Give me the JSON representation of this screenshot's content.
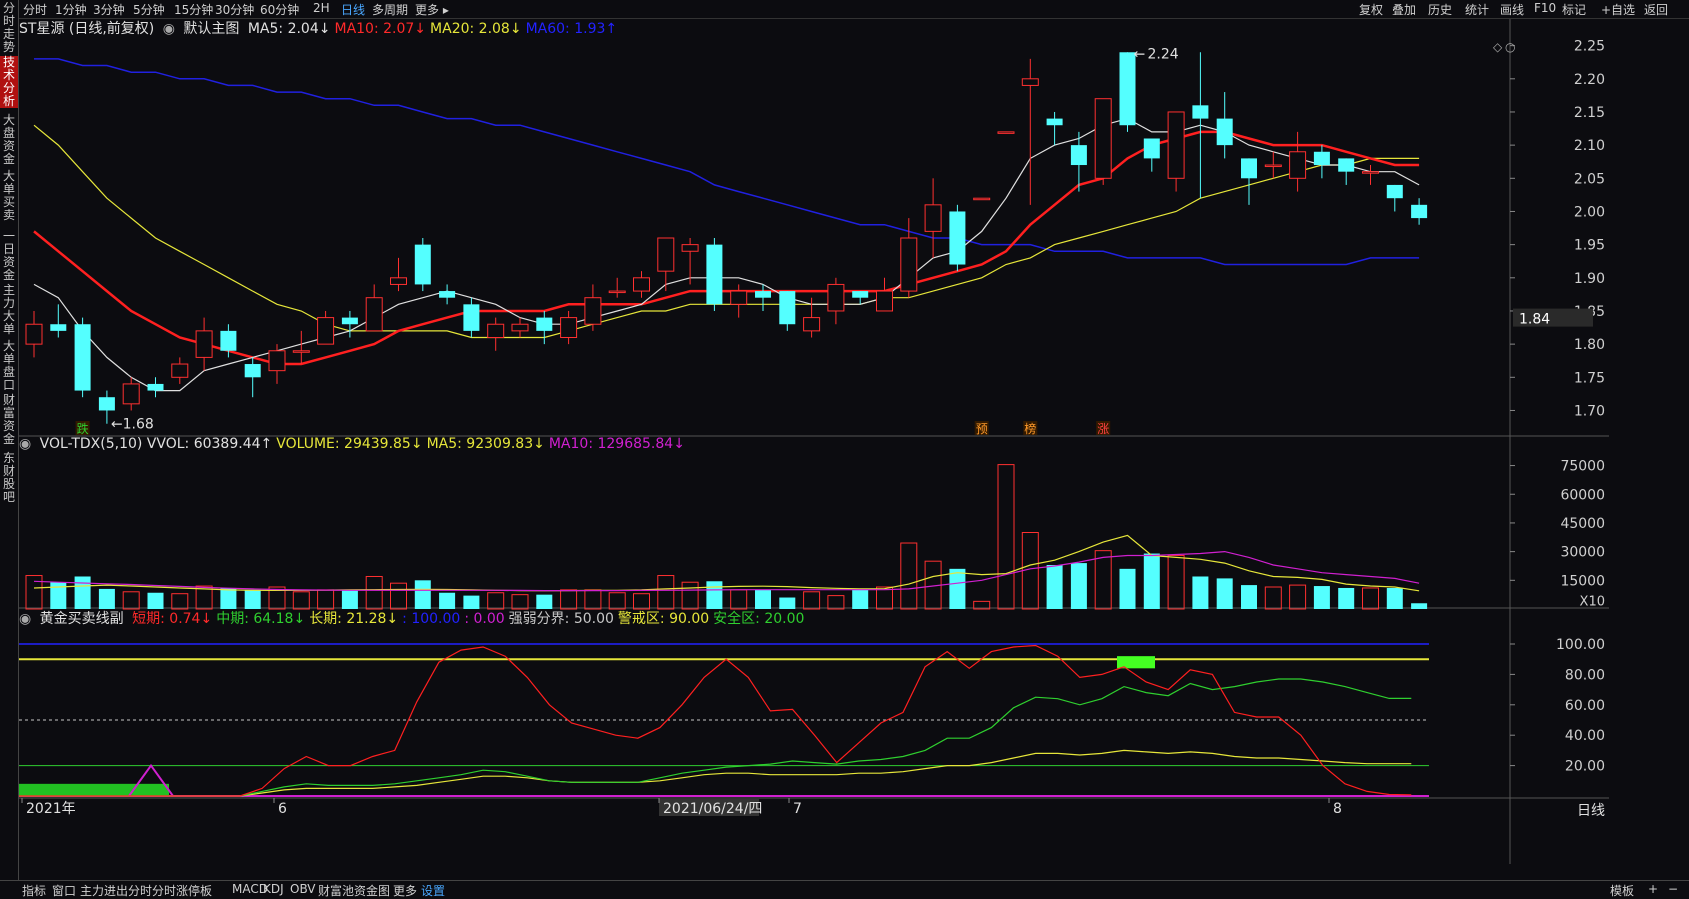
{
  "sidebar": {
    "items": [
      "分时走势",
      "技术分析",
      "大盘资金",
      "大单买卖",
      "一日资金",
      "主力大单",
      "大单盘口",
      "财富资金",
      "东财股吧"
    ],
    "active": 1
  },
  "topbar": {
    "periods": [
      "分时",
      "1分钟",
      "3分钟",
      "5分钟",
      "15分钟",
      "30分钟",
      "60分钟",
      "2H",
      "日线",
      "多周期",
      "更多 ▸"
    ],
    "selected": "日线",
    "right_buttons": [
      "复权",
      "叠加",
      "历史",
      "统计",
      "画线",
      "F10",
      "标记",
      "+自选",
      "返回"
    ]
  },
  "main_chart": {
    "stock": "ST星源 (日线,前复权)",
    "template": "默认主图",
    "ma_labels": [
      {
        "text": "MA5: 2.04",
        "arrow": "↓",
        "color": "#e0e0e0"
      },
      {
        "text": "MA10: 2.07",
        "arrow": "↓",
        "color": "#ff2a2a"
      },
      {
        "text": "MA20: 2.08",
        "arrow": "↓",
        "color": "#e6e63a"
      },
      {
        "text": "MA60: 1.93",
        "arrow": "↑",
        "color": "#2222ff"
      }
    ],
    "y_ticks": [
      "2.25",
      "2.20",
      "2.15",
      "2.10",
      "2.05",
      "2.00",
      "1.95",
      "1.90",
      "1.85",
      "1.80",
      "1.75",
      "1.70"
    ],
    "price_tag": "1.84",
    "high_label": "2.24",
    "low_label": "1.68",
    "markers": [
      {
        "text": "跌",
        "color": "#2fcf2f"
      },
      {
        "text": "预",
        "color": "#ff9a2a"
      },
      {
        "text": "榜",
        "color": "#ff9a2a"
      },
      {
        "text": "涨",
        "color": "#ff4040"
      }
    ]
  },
  "volume_chart": {
    "labels": [
      {
        "text": "VOL-TDX(5,10) VVOL: 60389.44",
        "arrow": "↑",
        "color": "#e0e0e0"
      },
      {
        "text": "VOLUME: 29439.85",
        "arrow": "↓",
        "color": "#e6e63a"
      },
      {
        "text": "MA5: 92309.83",
        "arrow": "↓",
        "color": "#e6e63a"
      },
      {
        "text": "MA10: 129685.84",
        "arrow": "↓",
        "color": "#d020d0"
      }
    ],
    "y_ticks": [
      "75000",
      "60000",
      "45000",
      "30000",
      "15000"
    ],
    "unit": "X10"
  },
  "indicator_chart": {
    "name": "黄金买卖线副",
    "labels": [
      {
        "text": "短期: 0.74",
        "arrow": "↓",
        "color": "#ff2a2a"
      },
      {
        "text": "中期: 64.18",
        "arrow": "↓",
        "color": "#2fcf2f"
      },
      {
        "text": "长期: 21.28",
        "arrow": "↓",
        "color": "#e6e63a"
      },
      {
        "text": ": 100.00",
        "arrow": "",
        "color": "#2222ff"
      },
      {
        "text": ": 0.00",
        "arrow": "",
        "color": "#d020d0"
      },
      {
        "text": "强弱分界: 50.00",
        "arrow": "",
        "color": "#c8c8c8"
      },
      {
        "text": "警戒区: 90.00",
        "arrow": "",
        "color": "#e6e63a"
      },
      {
        "text": "安全区: 20.00",
        "arrow": "",
        "color": "#2fcf2f"
      }
    ],
    "y_ticks": [
      "100.00",
      "80.00",
      "60.00",
      "40.00",
      "20.00"
    ]
  },
  "x_axis": {
    "labels": [
      "2021年",
      "6",
      "2021/06/24/四",
      "7",
      "8"
    ],
    "period": "日线"
  },
  "bottombar": {
    "items": [
      "指标",
      "窗口",
      "主力进出分时",
      "分时涨停板",
      "MACD",
      "KDJ",
      "OBV",
      "财富池资金图",
      "更多",
      "设置"
    ],
    "selected": "设置",
    "right": [
      "模板",
      "+",
      "−"
    ]
  },
  "colors": {
    "up": "#ff3030",
    "down": "#54ffff",
    "ma5": "#e0e0e0",
    "ma10": "#ff2020",
    "ma20": "#e6e63a",
    "ma60": "#2020e0"
  },
  "chart_data": {
    "type": "candlestick",
    "price": {
      "ylim": [
        1.66,
        2.26
      ],
      "candles": [
        [
          1.8,
          1.83,
          1.78,
          1.85
        ],
        [
          1.83,
          1.82,
          1.81,
          1.86
        ],
        [
          1.83,
          1.73,
          1.72,
          1.84
        ],
        [
          1.72,
          1.7,
          1.68,
          1.73
        ],
        [
          1.71,
          1.74,
          1.7,
          1.75
        ],
        [
          1.74,
          1.73,
          1.72,
          1.75
        ],
        [
          1.75,
          1.77,
          1.74,
          1.78
        ],
        [
          1.78,
          1.82,
          1.76,
          1.84
        ],
        [
          1.82,
          1.79,
          1.78,
          1.83
        ],
        [
          1.77,
          1.75,
          1.72,
          1.78
        ],
        [
          1.76,
          1.79,
          1.74,
          1.8
        ],
        [
          1.79,
          1.79,
          1.77,
          1.82
        ],
        [
          1.8,
          1.84,
          1.8,
          1.85
        ],
        [
          1.84,
          1.83,
          1.81,
          1.85
        ],
        [
          1.82,
          1.87,
          1.82,
          1.89
        ],
        [
          1.89,
          1.9,
          1.88,
          1.93
        ],
        [
          1.95,
          1.89,
          1.88,
          1.96
        ],
        [
          1.88,
          1.87,
          1.86,
          1.89
        ],
        [
          1.86,
          1.82,
          1.81,
          1.87
        ],
        [
          1.81,
          1.83,
          1.79,
          1.84
        ],
        [
          1.82,
          1.83,
          1.81,
          1.84
        ],
        [
          1.84,
          1.82,
          1.8,
          1.85
        ],
        [
          1.81,
          1.84,
          1.8,
          1.85
        ],
        [
          1.83,
          1.87,
          1.82,
          1.89
        ],
        [
          1.88,
          1.88,
          1.87,
          1.9
        ],
        [
          1.88,
          1.9,
          1.87,
          1.91
        ],
        [
          1.91,
          1.96,
          1.88,
          1.95
        ],
        [
          1.94,
          1.95,
          1.89,
          1.96
        ],
        [
          1.95,
          1.86,
          1.85,
          1.96
        ],
        [
          1.86,
          1.88,
          1.84,
          1.89
        ],
        [
          1.88,
          1.87,
          1.85,
          1.89
        ],
        [
          1.88,
          1.83,
          1.82,
          1.88
        ],
        [
          1.82,
          1.84,
          1.81,
          1.87
        ],
        [
          1.85,
          1.89,
          1.83,
          1.9
        ],
        [
          1.88,
          1.87,
          1.86,
          1.88
        ],
        [
          1.85,
          1.88,
          1.85,
          1.9
        ],
        [
          1.88,
          1.96,
          1.87,
          1.99
        ],
        [
          1.97,
          2.01,
          1.93,
          2.05
        ],
        [
          2.0,
          1.92,
          1.91,
          2.01
        ],
        [
          2.02,
          2.02,
          2.02,
          2.02
        ],
        [
          2.12,
          2.12,
          2.12,
          2.12
        ],
        [
          2.19,
          2.2,
          2.01,
          2.23
        ],
        [
          2.14,
          2.13,
          2.1,
          2.15
        ],
        [
          2.1,
          2.07,
          2.03,
          2.12
        ],
        [
          2.05,
          2.17,
          2.04,
          2.17
        ],
        [
          2.24,
          2.13,
          2.12,
          2.24
        ],
        [
          2.11,
          2.08,
          2.06,
          2.11
        ],
        [
          2.05,
          2.15,
          2.03,
          2.15
        ],
        [
          2.16,
          2.14,
          2.02,
          2.24
        ],
        [
          2.14,
          2.1,
          2.08,
          2.18
        ],
        [
          2.08,
          2.05,
          2.01,
          2.08
        ],
        [
          2.07,
          2.07,
          2.05,
          2.09
        ],
        [
          2.05,
          2.09,
          2.03,
          2.12
        ],
        [
          2.09,
          2.07,
          2.05,
          2.1
        ],
        [
          2.08,
          2.06,
          2.04,
          2.08
        ],
        [
          2.06,
          2.06,
          2.04,
          2.07
        ],
        [
          2.04,
          2.02,
          2.0,
          2.04
        ],
        [
          2.01,
          1.99,
          1.98,
          2.02
        ]
      ],
      "ma5": [
        1.89,
        1.87,
        1.82,
        1.78,
        1.75,
        1.73,
        1.73,
        1.76,
        1.77,
        1.78,
        1.79,
        1.8,
        1.81,
        1.82,
        1.84,
        1.86,
        1.87,
        1.88,
        1.87,
        1.86,
        1.84,
        1.83,
        1.83,
        1.84,
        1.85,
        1.86,
        1.89,
        1.9,
        1.9,
        1.9,
        1.89,
        1.87,
        1.86,
        1.86,
        1.86,
        1.87,
        1.9,
        1.93,
        1.94,
        1.97,
        2.02,
        2.08,
        2.1,
        2.11,
        2.13,
        2.14,
        2.12,
        2.12,
        2.13,
        2.12,
        2.1,
        2.09,
        2.08,
        2.07,
        2.07,
        2.06,
        2.06,
        2.04
      ],
      "ma10": [
        1.97,
        1.94,
        1.91,
        1.88,
        1.85,
        1.83,
        1.81,
        1.8,
        1.79,
        1.78,
        1.77,
        1.77,
        1.78,
        1.79,
        1.8,
        1.82,
        1.83,
        1.84,
        1.85,
        1.85,
        1.85,
        1.85,
        1.86,
        1.86,
        1.86,
        1.86,
        1.87,
        1.88,
        1.88,
        1.88,
        1.88,
        1.88,
        1.88,
        1.88,
        1.88,
        1.88,
        1.89,
        1.9,
        1.91,
        1.92,
        1.94,
        1.98,
        2.01,
        2.04,
        2.05,
        2.08,
        2.1,
        2.11,
        2.12,
        2.12,
        2.11,
        2.1,
        2.1,
        2.1,
        2.09,
        2.08,
        2.07,
        2.07
      ],
      "ma20": [
        2.13,
        2.1,
        2.06,
        2.02,
        1.99,
        1.96,
        1.94,
        1.92,
        1.9,
        1.88,
        1.86,
        1.85,
        1.83,
        1.82,
        1.82,
        1.82,
        1.82,
        1.82,
        1.81,
        1.81,
        1.81,
        1.81,
        1.82,
        1.83,
        1.84,
        1.85,
        1.85,
        1.86,
        1.86,
        1.86,
        1.86,
        1.86,
        1.86,
        1.86,
        1.86,
        1.87,
        1.87,
        1.88,
        1.89,
        1.9,
        1.92,
        1.93,
        1.95,
        1.96,
        1.97,
        1.98,
        1.99,
        2.0,
        2.02,
        2.03,
        2.04,
        2.05,
        2.06,
        2.07,
        2.07,
        2.08,
        2.08,
        2.08
      ],
      "ma60": [
        2.23,
        2.23,
        2.22,
        2.22,
        2.21,
        2.21,
        2.2,
        2.2,
        2.19,
        2.19,
        2.18,
        2.18,
        2.17,
        2.17,
        2.16,
        2.16,
        2.15,
        2.14,
        2.14,
        2.13,
        2.13,
        2.12,
        2.11,
        2.1,
        2.09,
        2.08,
        2.07,
        2.06,
        2.04,
        2.03,
        2.02,
        2.01,
        2.0,
        1.99,
        1.98,
        1.98,
        1.97,
        1.96,
        1.96,
        1.95,
        1.95,
        1.95,
        1.94,
        1.94,
        1.94,
        1.93,
        1.93,
        1.93,
        1.93,
        1.92,
        1.92,
        1.92,
        1.92,
        1.92,
        1.92,
        1.93,
        1.93,
        1.93
      ]
    },
    "volume": {
      "ylim": [
        0,
        80000
      ],
      "values": [
        17500,
        14000,
        17000,
        10500,
        9000,
        8500,
        8000,
        12000,
        11000,
        10000,
        11500,
        9000,
        10000,
        10000,
        17000,
        13500,
        15000,
        8500,
        7000,
        8500,
        7500,
        7500,
        10000,
        10000,
        8500,
        8000,
        17500,
        14000,
        14500,
        10000,
        10000,
        6000,
        9000,
        7000,
        10000,
        11500,
        34500,
        25000,
        21000,
        4000,
        75500,
        40000,
        23000,
        24000,
        30500,
        21000,
        29000,
        28000,
        17000,
        16000,
        12500,
        11500,
        12500,
        12000,
        11000,
        11000,
        11000,
        3000
      ],
      "ma5": [
        11000,
        11500,
        12000,
        12500,
        12000,
        11500,
        11000,
        10500,
        10000,
        9800,
        9700,
        9800,
        9900,
        10000,
        10100,
        10200,
        10300,
        10200,
        10000,
        9800,
        9600,
        9500,
        9600,
        9700,
        9800,
        10000,
        10500,
        11000,
        11500,
        11800,
        11900,
        11700,
        11200,
        10800,
        10500,
        10600,
        13000,
        17000,
        19000,
        18000,
        18500,
        23000,
        25500,
        30000,
        35000,
        38500,
        28000,
        27000,
        26000,
        24000,
        20000,
        17000,
        16500,
        15500,
        13000,
        12000,
        11500,
        9500
      ],
      "ma10": [
        14500,
        14000,
        13600,
        13200,
        12800,
        12300,
        11800,
        11300,
        10900,
        10500,
        10200,
        10000,
        9900,
        9800,
        9800,
        9800,
        9800,
        9800,
        9800,
        9800,
        9700,
        9600,
        9600,
        9600,
        9600,
        9700,
        9800,
        9900,
        10000,
        10100,
        10100,
        10100,
        10100,
        10100,
        10100,
        10100,
        10500,
        12000,
        13500,
        15000,
        18000,
        21000,
        22500,
        24500,
        27000,
        28000,
        28000,
        28500,
        29000,
        30000,
        27000,
        23000,
        21000,
        19000,
        18000,
        17000,
        16000,
        13500
      ]
    },
    "indicator": {
      "ylim": [
        0,
        100
      ],
      "short": [
        0,
        0,
        0,
        0,
        0,
        0,
        0,
        0,
        0,
        0,
        0,
        5,
        18,
        26,
        20,
        20,
        26,
        30,
        62,
        88,
        96,
        98,
        92,
        78,
        60,
        48,
        44,
        40,
        38,
        45,
        60,
        78,
        90,
        78,
        56,
        57,
        40,
        22,
        35,
        48,
        55,
        85,
        95,
        84,
        95,
        98,
        99,
        92,
        78,
        80,
        85,
        75,
        70,
        83,
        80,
        55,
        52,
        52,
        40,
        20,
        8,
        3,
        1,
        0.74
      ],
      "mid": [
        0,
        0,
        0,
        0,
        0,
        0,
        0,
        0,
        0,
        0,
        0,
        3,
        6,
        8,
        7,
        7,
        7,
        8,
        10,
        12,
        14,
        17,
        16,
        13,
        10,
        9,
        9,
        9,
        9,
        12,
        15,
        17,
        19,
        20,
        21,
        23,
        22,
        21,
        23,
        24,
        26,
        30,
        38,
        38,
        45,
        58,
        65,
        64,
        60,
        64,
        72,
        68,
        66,
        74,
        70,
        72,
        75,
        77,
        77,
        75,
        72,
        68,
        64.18,
        64.18
      ],
      "long": [
        0,
        0,
        0,
        0,
        0,
        0,
        0,
        0,
        0,
        0,
        0,
        2,
        4,
        5,
        5,
        5,
        5,
        6,
        7,
        9,
        11,
        13,
        13,
        12,
        10,
        9,
        9,
        9,
        9,
        10,
        12,
        14,
        15,
        15,
        14,
        14,
        14,
        14,
        15,
        15,
        16,
        18,
        20,
        20,
        22,
        25,
        28,
        28,
        27,
        28,
        30,
        29,
        28,
        29,
        28,
        26,
        25,
        25,
        24,
        23,
        22,
        21.28,
        21.28,
        21.28
      ],
      "lines": {
        "top": 100,
        "warn": 90,
        "mid": 50,
        "safe": 20,
        "bottom": 0
      }
    }
  }
}
